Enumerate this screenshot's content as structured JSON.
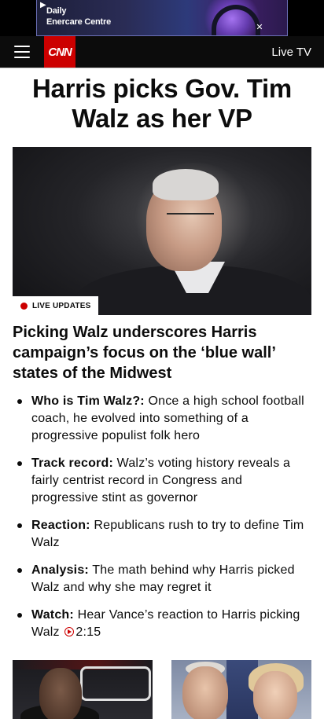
{
  "ad": {
    "line1": "Daily",
    "line2": "Enercare Centre",
    "play_icon": "play-icon",
    "close_icon": "close-icon"
  },
  "header": {
    "logo": "CNN",
    "live_tv": "Live TV",
    "menu_icon": "hamburger-menu-icon",
    "background": "#0c0c0c",
    "logo_color": "#cc0000"
  },
  "headline": "Harris picks Gov. Tim Walz as her VP",
  "hero": {
    "badge": "LIVE UPDATES",
    "badge_dot_color": "#cc0000"
  },
  "subhead": "Picking Walz underscores Harris campaign’s focus on the ‘blue wall’ states of the Midwest",
  "bullets": [
    {
      "lead": "Who is Tim Walz?:",
      "text": " Once a high school football coach, he evolved into something of a progressive populist folk hero"
    },
    {
      "lead": "Track record:",
      "text": " Walz’s voting history reveals a fairly centrist record in Congress and progressive stint as governor"
    },
    {
      "lead": "Reaction:",
      "text": " Republicans rush to try to define Tim Walz"
    },
    {
      "lead": "Analysis:",
      "text": " The math behind why Harris picked Walz and why she may regret it"
    },
    {
      "lead": "Watch:",
      "text": " Hear Vance’s reaction to Harris picking Walz ",
      "video_duration": "2:15",
      "video_icon": "play-circle-icon"
    }
  ],
  "thumbnails": [
    {
      "name": "video-thumbnail-commentator"
    },
    {
      "name": "photo-thumbnail-walz"
    }
  ]
}
